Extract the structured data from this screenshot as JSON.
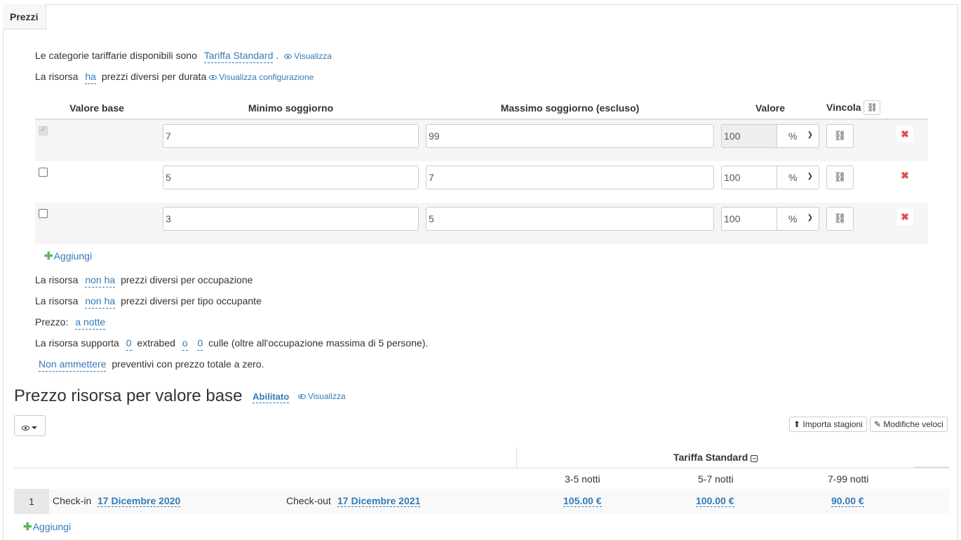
{
  "tab": {
    "label": "Prezzi"
  },
  "rate_categories": {
    "text": "Le categorie tariffarie disponibili sono",
    "value": "Tariffa Standard",
    "suffix": ".",
    "view_link": "Visualizza"
  },
  "duration": {
    "prefix": "La risorsa",
    "value": "ha",
    "text": "prezzi diversi per durata",
    "view_link": "Visualizza configurazione"
  },
  "duration_table": {
    "headers": {
      "base": "Valore base",
      "min": "Minimo soggiorno",
      "max": "Massimo soggiorno (escluso)",
      "value": "Valore",
      "link": "Vincola"
    },
    "rows": [
      {
        "base_checked": true,
        "min": "7",
        "max": "99",
        "value": "100",
        "unit": "%"
      },
      {
        "base_checked": false,
        "min": "5",
        "max": "7",
        "value": "100",
        "unit": "%"
      },
      {
        "base_checked": false,
        "min": "3",
        "max": "5",
        "value": "100",
        "unit": "%"
      }
    ],
    "add_label": "Aggiungi"
  },
  "occupancy": {
    "prefix": "La risorsa",
    "value": "non ha",
    "text": "prezzi diversi per occupazione"
  },
  "occupant_type": {
    "prefix": "La risorsa",
    "value": "non ha",
    "text": "prezzi diversi per tipo occupante"
  },
  "price_mode": {
    "prefix": "Prezzo:",
    "value": "a notte"
  },
  "extras": {
    "prefix": "La risorsa supporta",
    "extrabed_value": "0",
    "extrabed_text": "extrabed",
    "connector": "o",
    "cribs_value": "0",
    "cribs_text": "culle (oltre all'occupazione massima di 5 persone)."
  },
  "zero_price": {
    "value": "Non ammettere",
    "text": "preventivi con prezzo totale a zero."
  },
  "base_price_section": {
    "title": "Prezzo risorsa per valore base",
    "status": "Abilitato",
    "view_link": "Visualizza",
    "import_button": "Importa stagioni",
    "quick_edit_button": "Modifiche veloci",
    "rate_header": "Tariffa Standard",
    "columns": [
      "3-5 notti",
      "5-7 notti",
      "7-99 notti"
    ],
    "seasons": [
      {
        "index": "1",
        "checkin_label": "Check-in",
        "checkin_date": "17 Dicembre 2020",
        "checkout_label": "Check-out",
        "checkout_date": "17 Dicembre 2021",
        "prices": [
          "105.00 €",
          "100.00 €",
          "90.00 €"
        ]
      }
    ],
    "add_label": "Aggiungi"
  }
}
